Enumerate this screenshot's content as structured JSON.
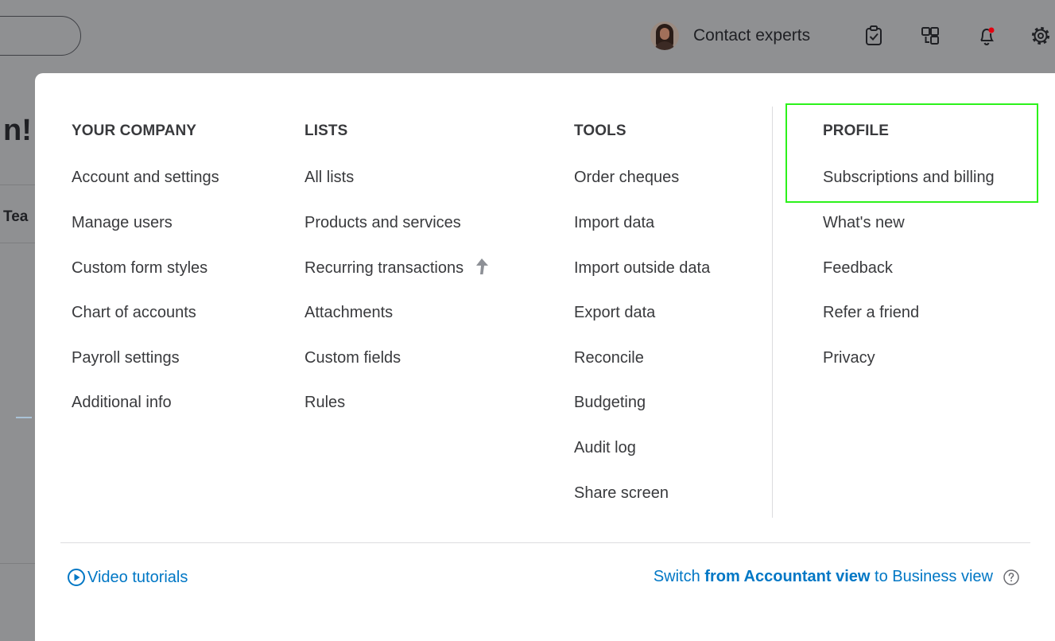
{
  "topbar": {
    "contact_experts": "Contact experts"
  },
  "background": {
    "heading_fragment": "n!",
    "tab_fragment": "Tea"
  },
  "menu": {
    "columns": [
      {
        "title": "YOUR COMPANY",
        "items": [
          "Account and settings",
          "Manage users",
          "Custom form styles",
          "Chart of accounts",
          "Payroll settings",
          "Additional info"
        ]
      },
      {
        "title": "LISTS",
        "items": [
          "All lists",
          "Products and services",
          "Recurring transactions",
          "Attachments",
          "Custom fields",
          "Rules"
        ]
      },
      {
        "title": "TOOLS",
        "items": [
          "Order cheques",
          "Import data",
          "Import outside data",
          "Export data",
          "Reconcile",
          "Budgeting",
          "Audit log",
          "Share screen"
        ]
      },
      {
        "title": "PROFILE",
        "items": [
          "Subscriptions and billing",
          "What's new",
          "Feedback",
          "Refer a friend",
          "Privacy"
        ]
      }
    ]
  },
  "footer": {
    "video_tutorials": "Video tutorials",
    "switch_prefix": "Switch",
    "switch_bold": "from Accountant view",
    "switch_suffix": "to Business view"
  },
  "colors": {
    "link_blue": "#0077c5",
    "highlight_green": "#2cf21b",
    "overlay_gray": "#8f9092"
  },
  "icons": [
    "upgrade-arrow-icon",
    "play-circle-icon",
    "help-circle-icon",
    "checklist-icon",
    "apps-icon",
    "bell-icon",
    "gear-icon"
  ]
}
